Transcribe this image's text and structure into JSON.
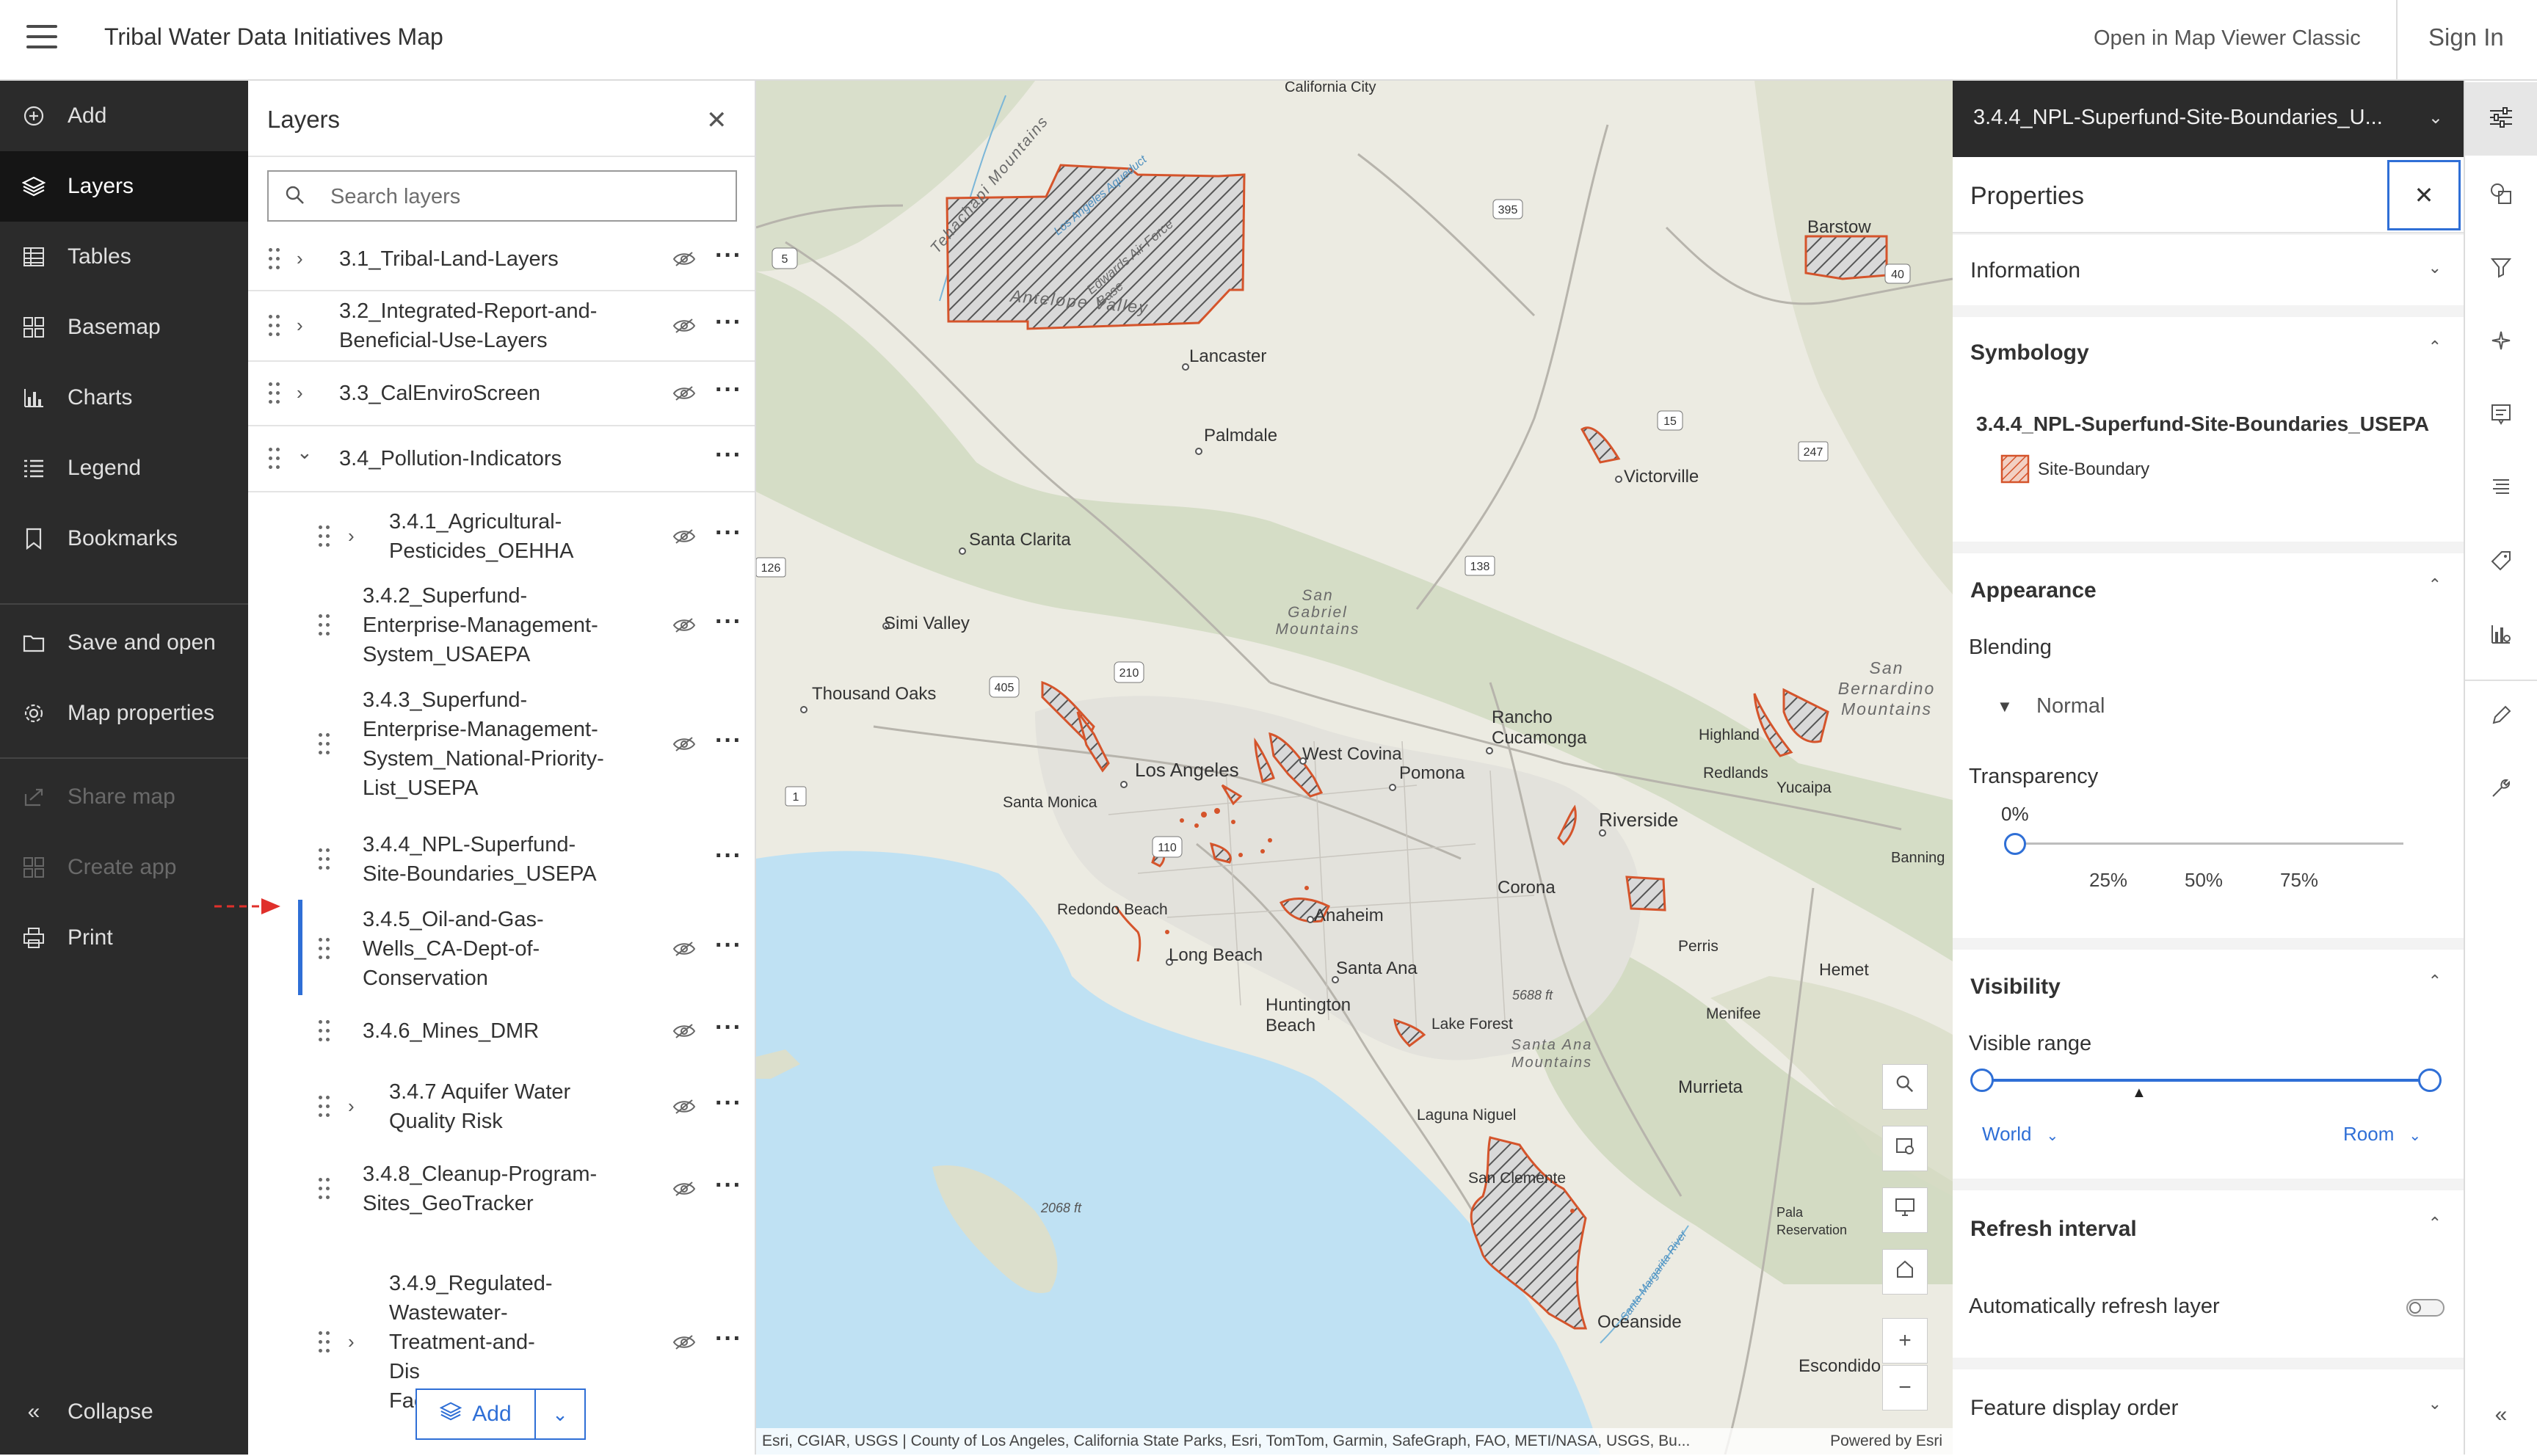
{
  "header": {
    "title": "Tribal Water Data Initiatives Map",
    "open_classic": "Open in Map Viewer Classic",
    "sign_in": "Sign In"
  },
  "nav": {
    "items": [
      {
        "label": "Add",
        "icon": "plus-circle-icon"
      },
      {
        "label": "Layers",
        "icon": "layers-icon"
      },
      {
        "label": "Tables",
        "icon": "table-icon"
      },
      {
        "label": "Basemap",
        "icon": "basemap-icon"
      },
      {
        "label": "Charts",
        "icon": "chart-icon"
      },
      {
        "label": "Legend",
        "icon": "legend-icon"
      },
      {
        "label": "Bookmarks",
        "icon": "bookmark-icon"
      },
      {
        "label": "Save and open",
        "icon": "folder-icon"
      },
      {
        "label": "Map properties",
        "icon": "gear-icon"
      },
      {
        "label": "Share map",
        "icon": "share-icon"
      },
      {
        "label": "Create app",
        "icon": "apps-icon"
      },
      {
        "label": "Print",
        "icon": "print-icon"
      }
    ],
    "collapse": "Collapse"
  },
  "layers": {
    "title": "Layers",
    "search_placeholder": "Search layers",
    "add_label": "Add",
    "rows": [
      {
        "lines": [
          "3.1_Tribal-Land-Layers"
        ]
      },
      {
        "lines": [
          "3.2_Integrated-Report-and-",
          "Beneficial-Use-Layers"
        ]
      },
      {
        "lines": [
          "3.3_CalEnviroScreen"
        ]
      },
      {
        "lines": [
          "3.4_Pollution-Indicators"
        ]
      },
      {
        "lines": [
          "3.4.1_Agricultural-",
          "Pesticides_OEHHA"
        ]
      },
      {
        "lines": [
          "3.4.2_Superfund-",
          "Enterprise-Management-",
          "System_USAEPA"
        ]
      },
      {
        "lines": [
          "3.4.3_Superfund-",
          "Enterprise-Management-",
          "System_National-Priority-",
          "List_USEPA"
        ]
      },
      {
        "lines": [
          "3.4.4_NPL-Superfund-",
          "Site-Boundaries_USEPA"
        ]
      },
      {
        "lines": [
          "3.4.5_Oil-and-Gas-",
          "Wells_CA-Dept-of-",
          "Conservation"
        ]
      },
      {
        "lines": [
          "3.4.6_Mines_DMR"
        ]
      },
      {
        "lines": [
          "3.4.7 Aquifer Water",
          "Quality Risk"
        ]
      },
      {
        "lines": [
          "3.4.8_Cleanup-Program-",
          "Sites_GeoTracker"
        ]
      },
      {
        "lines": [
          "3.4.9_Regulated-",
          "Wastewater-",
          "Treatment-and-",
          "Dis",
          "Facilities_CIWQS"
        ]
      }
    ]
  },
  "map": {
    "labels": {
      "california_city": "California City",
      "lancaster": "Lancaster",
      "antelope_valley": "Antelope Valley",
      "palmdale": "Palmdale",
      "barstow": "Barstow",
      "victorville": "Victorville",
      "santa_clarita": "Santa Clarita",
      "simi_valley": "Simi Valley",
      "thousand_oaks": "Thousand Oaks",
      "san_gabriel": "San Gabriel Mountains",
      "san_bernardino": "San Bernardino Mountains",
      "los_angeles": "Los Angeles",
      "west_covina": "West Covina",
      "pomona": "Pomona",
      "rancho": "Rancho Cucamonga",
      "highland": "Highland",
      "redlands": "Redlands",
      "yucaipa": "Yucaipa",
      "santa_monica": "Santa Monica",
      "riverside": "Riverside",
      "banning": "Banning",
      "corona": "Corona",
      "redondo": "Redondo Beach",
      "anaheim": "Anaheim",
      "long_beach": "Long Beach",
      "perris": "Perris",
      "hemet": "Hemet",
      "santa_ana": "Santa Ana",
      "huntington": "Huntington Beach",
      "lake_forest": "Lake Forest",
      "menifee": "Menifee",
      "santa_ana_mtns": "Santa Ana Mountains",
      "murrieta": "Murrieta",
      "laguna_niguel": "Laguna Niguel",
      "san_clemente": "San Clemente",
      "pala": "Pala Reservation",
      "oceanside": "Oceanside",
      "escondido": "Escondido",
      "tehachapi": "Tehachapi Mountains",
      "la_aqueduct": "Los Angeles Aqueduct",
      "edwards": "Edwards Air Force Base",
      "peak_2068": "2068 ft",
      "peak_5688": "5688 ft",
      "sa_river": "Santa Margarita River",
      "rt5": "5",
      "rt395": "395",
      "rt40": "40",
      "rt15": "15",
      "rt247": "247",
      "rt138": "138",
      "rt126": "126",
      "rt405": "405",
      "rt210": "210",
      "rt1": "1",
      "rt110": "110"
    },
    "attribution": "Esri, CGIAR, USGS | County of Los Angeles, California State Parks, Esri, TomTom, Garmin, SafeGraph, FAO, METI/NASA, USGS, Bu...",
    "powered": "Powered by Esri",
    "colors": {
      "boundary": "#d5542b",
      "water": "#bfe1f3"
    }
  },
  "props": {
    "layer_name_short": "3.4.4_NPL-Superfund-Site-Boundaries_U...",
    "title": "Properties",
    "information": "Information",
    "symbology": "Symbology",
    "sym_layer": "3.4.4_NPL-Superfund-Site-Boundaries_USEPA",
    "sym_item": "Site-Boundary",
    "appearance": "Appearance",
    "blending": "Blending",
    "blend_value": "Normal",
    "transparency": "Transparency",
    "transparency_value": "0%",
    "ticks": [
      "25%",
      "50%",
      "75%"
    ],
    "visibility": "Visibility",
    "visible_range": "Visible range",
    "range_min": "World",
    "range_max": "Room",
    "refresh": "Refresh interval",
    "auto_refresh": "Automatically refresh layer",
    "feature_order": "Feature display order"
  }
}
